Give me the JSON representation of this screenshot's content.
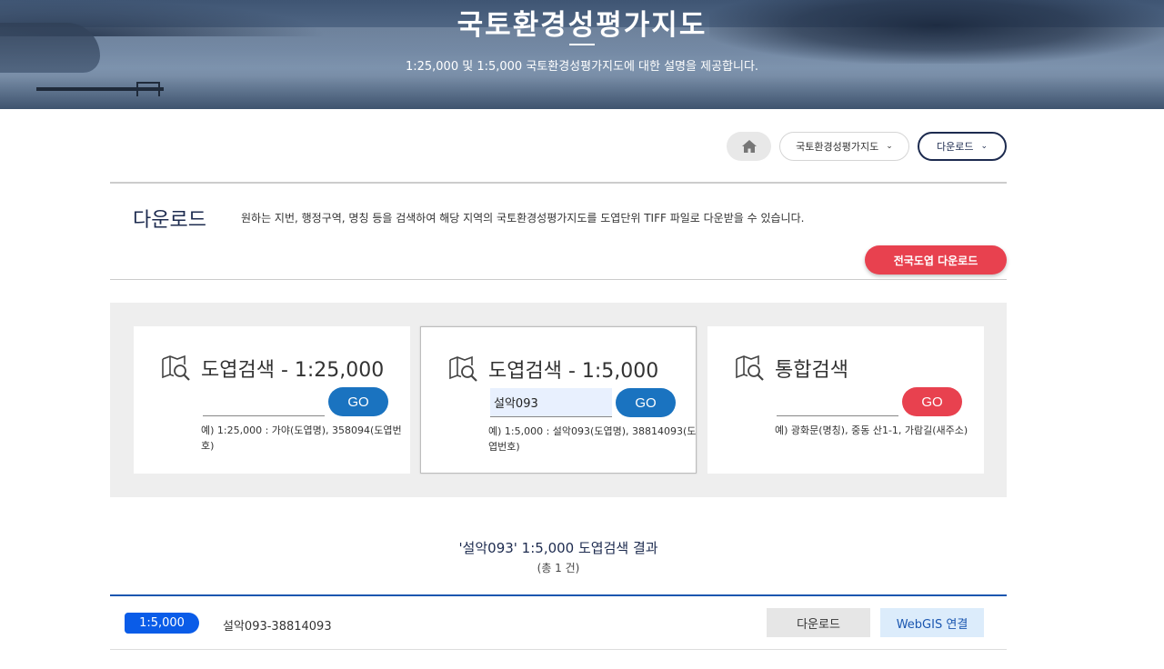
{
  "banner": {
    "title": "국토환경성평가지도",
    "subtitle": "1:25,000 및 1:5,000 국토환경성평가지도에 대한 설명을 제공합니다."
  },
  "nav": {
    "home_icon": "home-icon",
    "map_label": "국토환경성평가지도",
    "download_label": "다운로드"
  },
  "header": {
    "title": "다운로드",
    "description": "원하는 지번, 행정구역, 명칭 등을 검색하여 해당 지역의 국토환경성평가지도를 도엽단위 TIFF 파일로 다운받을 수 있습니다.",
    "all_download_label": "전국도엽 다운로드"
  },
  "search": {
    "cards": [
      {
        "title": "도엽검색 - 1:25,000",
        "value": "",
        "go_label": "GO",
        "hint": "예) 1:25,000 : 가야(도엽명), 358094(도엽번호)"
      },
      {
        "title": "도엽검색 - 1:5,000",
        "value": "설악093",
        "go_label": "GO",
        "hint": "예) 1:5,000 : 설악093(도엽명), 38814093(도엽번호)"
      },
      {
        "title": "통합검색",
        "value": "",
        "go_label": "GO",
        "hint": "예) 광화문(명칭), 중동 산1-1, 가람길(새주소)"
      }
    ]
  },
  "results": {
    "title": "'설악093' 1:5,000 도엽검색 결과",
    "count": "(총 1 건)",
    "rows": [
      {
        "scale": "1:5,000",
        "name": "설악093-38814093",
        "download_label": "다운로드",
        "webgis_label": "WebGIS 연결"
      }
    ]
  },
  "colors": {
    "navy": "#1d2b4f",
    "accent_red": "#e8414f",
    "go_blue": "#1a73c0",
    "badge_blue": "#0a5ce8"
  }
}
